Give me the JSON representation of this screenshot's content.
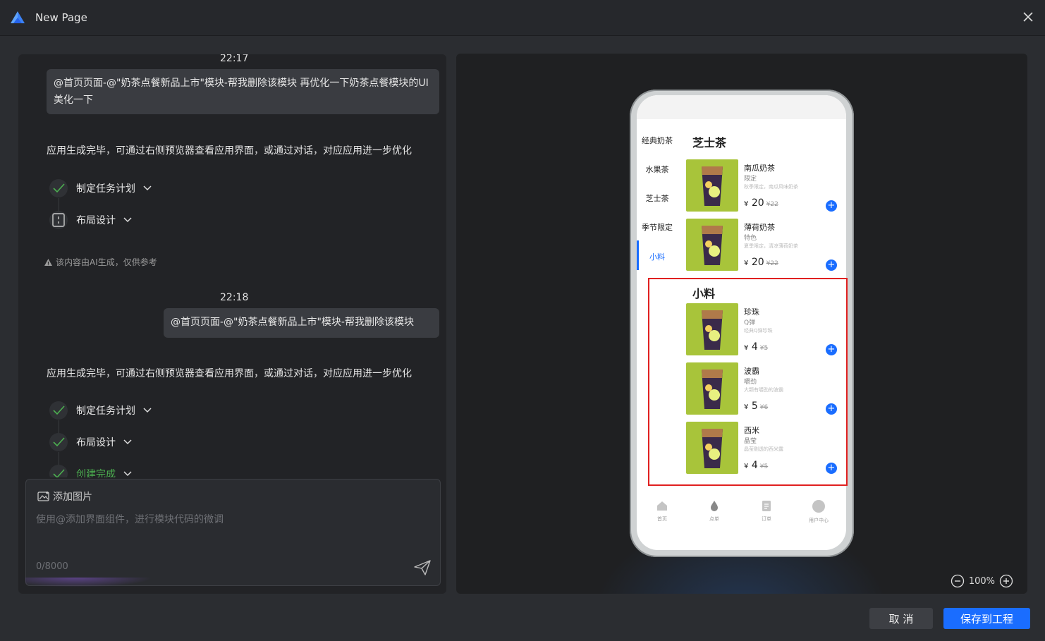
{
  "window": {
    "title": "New Page"
  },
  "chat": {
    "messages": [
      {
        "time": "22:17",
        "user": "@首页页面-@\"奶茶点餐新品上市\"模块-帮我删除该模块 再优化一下奶茶点餐模块的UI美化一下"
      },
      {
        "time": "22:18",
        "user": "@首页页面-@\"奶茶点餐新品上市\"模块-帮我删除该模块"
      }
    ],
    "reply": "应用生成完毕，可通过右侧预览器查看应用界面，或通过对话，对应应用进一步优化",
    "steps_1": [
      "制定任务计划",
      "布局设计"
    ],
    "steps_2": [
      "制定任务计划",
      "布局设计",
      "创建完成"
    ],
    "disclaimer": "该内容由AI生成，仅供参考"
  },
  "input": {
    "add_image": "添加图片",
    "placeholder": "使用@添加界面组件，进行模块代码的微调",
    "count": "0/8000"
  },
  "preview": {
    "categories": [
      "经典奶茶",
      "水果茶",
      "芝士茶",
      "季节限定",
      "小料"
    ],
    "active_category": "小料",
    "sections": [
      {
        "title": "芝士茶",
        "items": [
          {
            "name": "南瓜奶茶",
            "tag": "限定",
            "desc": "秋季限定，南瓜风味奶茶",
            "price": "20",
            "orig": "¥22"
          },
          {
            "name": "薄荷奶茶",
            "tag": "特色",
            "desc": "夏季限定，清凉薄荷奶茶",
            "price": "20",
            "orig": "¥22"
          }
        ]
      },
      {
        "title": "小料",
        "items": [
          {
            "name": "珍珠",
            "tag": "Q弹",
            "desc": "经典Q弹珍珠",
            "price": "4",
            "orig": "¥5"
          },
          {
            "name": "波霸",
            "tag": "嚼劲",
            "desc": "大颗有嚼劲的波霸",
            "price": "5",
            "orig": "¥6"
          },
          {
            "name": "西米",
            "tag": "晶莹",
            "desc": "晶莹剔透的西米露",
            "price": "4",
            "orig": "¥5"
          }
        ]
      }
    ],
    "currency": "¥",
    "tabs": [
      "首页",
      "点单",
      "订单",
      "用户中心"
    ],
    "zoom": "100%"
  },
  "footer": {
    "cancel": "取 消",
    "save": "保存到工程"
  },
  "colors": {
    "accent": "#1a6dff",
    "success": "#4caf50",
    "highlight": "#e02020"
  }
}
